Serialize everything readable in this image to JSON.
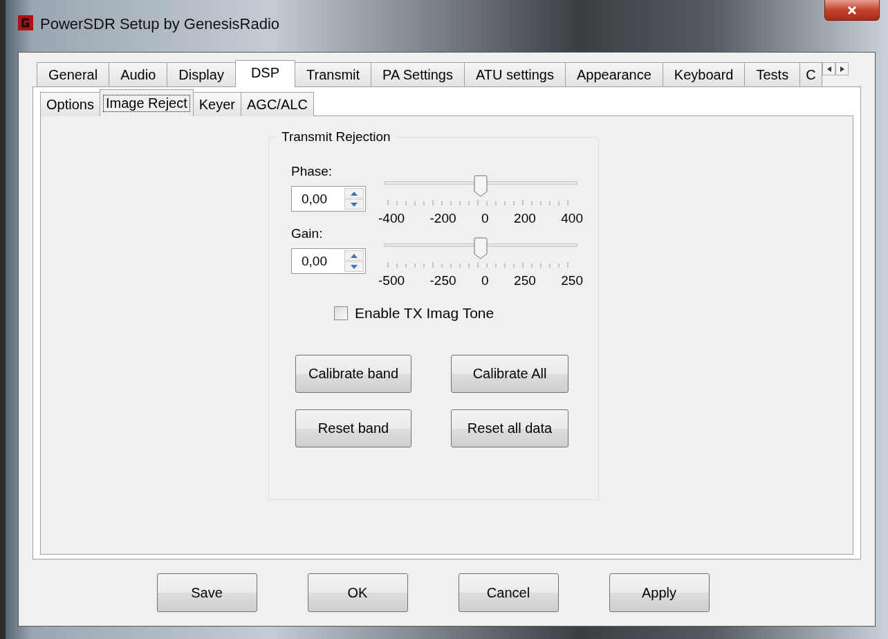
{
  "window": {
    "title": "PowerSDR Setup by GenesisRadio"
  },
  "tabs": [
    {
      "label": "General",
      "selected": false
    },
    {
      "label": "Audio",
      "selected": false
    },
    {
      "label": "Display",
      "selected": false
    },
    {
      "label": "DSP",
      "selected": true
    },
    {
      "label": "Transmit",
      "selected": false
    },
    {
      "label": "PA Settings",
      "selected": false
    },
    {
      "label": "ATU settings",
      "selected": false
    },
    {
      "label": "Appearance",
      "selected": false
    },
    {
      "label": "Keyboard",
      "selected": false
    },
    {
      "label": "Tests",
      "selected": false
    },
    {
      "label": "C",
      "selected": false
    }
  ],
  "subtabs": [
    {
      "label": "Options",
      "selected": false
    },
    {
      "label": "Image Reject",
      "selected": true
    },
    {
      "label": "Keyer",
      "selected": false
    },
    {
      "label": "AGC/ALC",
      "selected": false
    }
  ],
  "group": {
    "title": "Transmit Rejection",
    "sliders": [
      {
        "label": "Phase:",
        "value": "0,00",
        "level": 0.5,
        "ticks": [
          "-400",
          "-200",
          "0",
          "200",
          "400"
        ]
      },
      {
        "label": "Gain:",
        "value": "0,00",
        "level": 0.5,
        "ticks": [
          "-500",
          "-250",
          "0",
          "250",
          "250"
        ]
      }
    ],
    "checkbox": {
      "label": "Enable TX Imag Tone",
      "checked": false
    },
    "buttons": [
      "Calibrate band",
      "Calibrate All",
      "Reset band",
      "Reset all data"
    ]
  },
  "buttons": [
    "Save",
    "OK",
    "Cancel",
    "Apply"
  ]
}
